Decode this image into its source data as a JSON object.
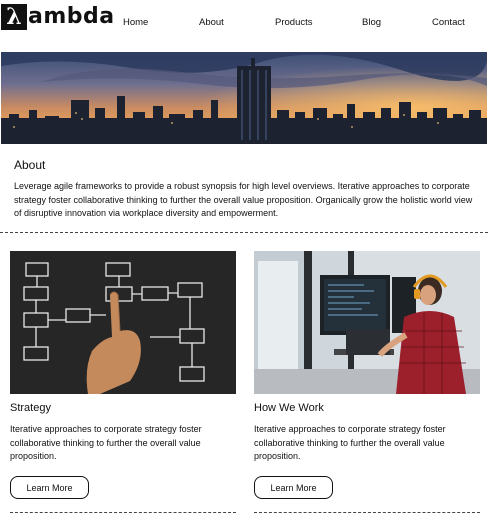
{
  "brand": {
    "logo_letter": "λ",
    "logo_text": "ambda"
  },
  "nav": {
    "home": "Home",
    "about": "About",
    "products": "Products",
    "blog": "Blog",
    "contact": "Contact"
  },
  "about": {
    "title": "About",
    "text": "Leverage agile frameworks to provide a robust synopsis for high level overviews. Iterative approaches to corporate strategy foster collaborative thinking to further the overall value proposition. Organically grow the holistic world view of disruptive innovation via workplace diversity and empowerment."
  },
  "cards": [
    {
      "title": "Strategy",
      "text": "Iterative approaches to corporate strategy foster collaborative thinking to further the overall value proposition.",
      "button": "Learn More"
    },
    {
      "title": "How We Work",
      "text": "Iterative approaches to corporate strategy foster collaborative thinking to further the overall value proposition.",
      "button": "Learn More"
    }
  ]
}
